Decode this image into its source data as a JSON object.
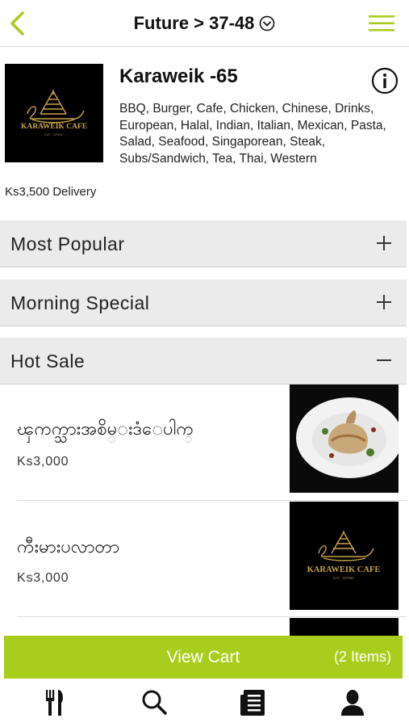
{
  "header": {
    "title": "Future > 37-48",
    "back_icon": "chevron-left-icon",
    "menu_icon": "hamburger-icon"
  },
  "restaurant": {
    "name": "Karaweik -65",
    "logo_text": "KARAWEIK CAFE",
    "logo_subtext": "EAT · DRINK",
    "cuisines": "BBQ, Burger, Cafe, Chicken, Chinese, Drinks, European, Halal, Indian, Italian, Mexican, Pasta, Salad, Seafood, Singaporean, Steak, Subs/Sandwich, Tea, Thai, Western",
    "delivery": "Ks3,500 Delivery"
  },
  "categories": [
    {
      "label": "Most Popular",
      "state": "collapsed"
    },
    {
      "label": "Morning Special",
      "state": "collapsed"
    },
    {
      "label": "Hot Sale",
      "state": "expanded"
    }
  ],
  "items": [
    {
      "name": "ၾကက္သားအစိမ္းဒံေပါက္",
      "price": "Ks3,000",
      "image": "chicken-plate"
    },
    {
      "name": "ကီးမားပလာတာ",
      "price": "Ks3,000",
      "image": "karaweik-logo"
    }
  ],
  "cart": {
    "label": "View Cart",
    "count": "(2 Items)"
  },
  "tabs": [
    "restaurants-icon",
    "search-icon",
    "orders-icon",
    "profile-icon"
  ],
  "colors": {
    "accent": "#a9cd1c",
    "category_bg": "#ebebeb",
    "logo_gold": "#c9a34a"
  }
}
